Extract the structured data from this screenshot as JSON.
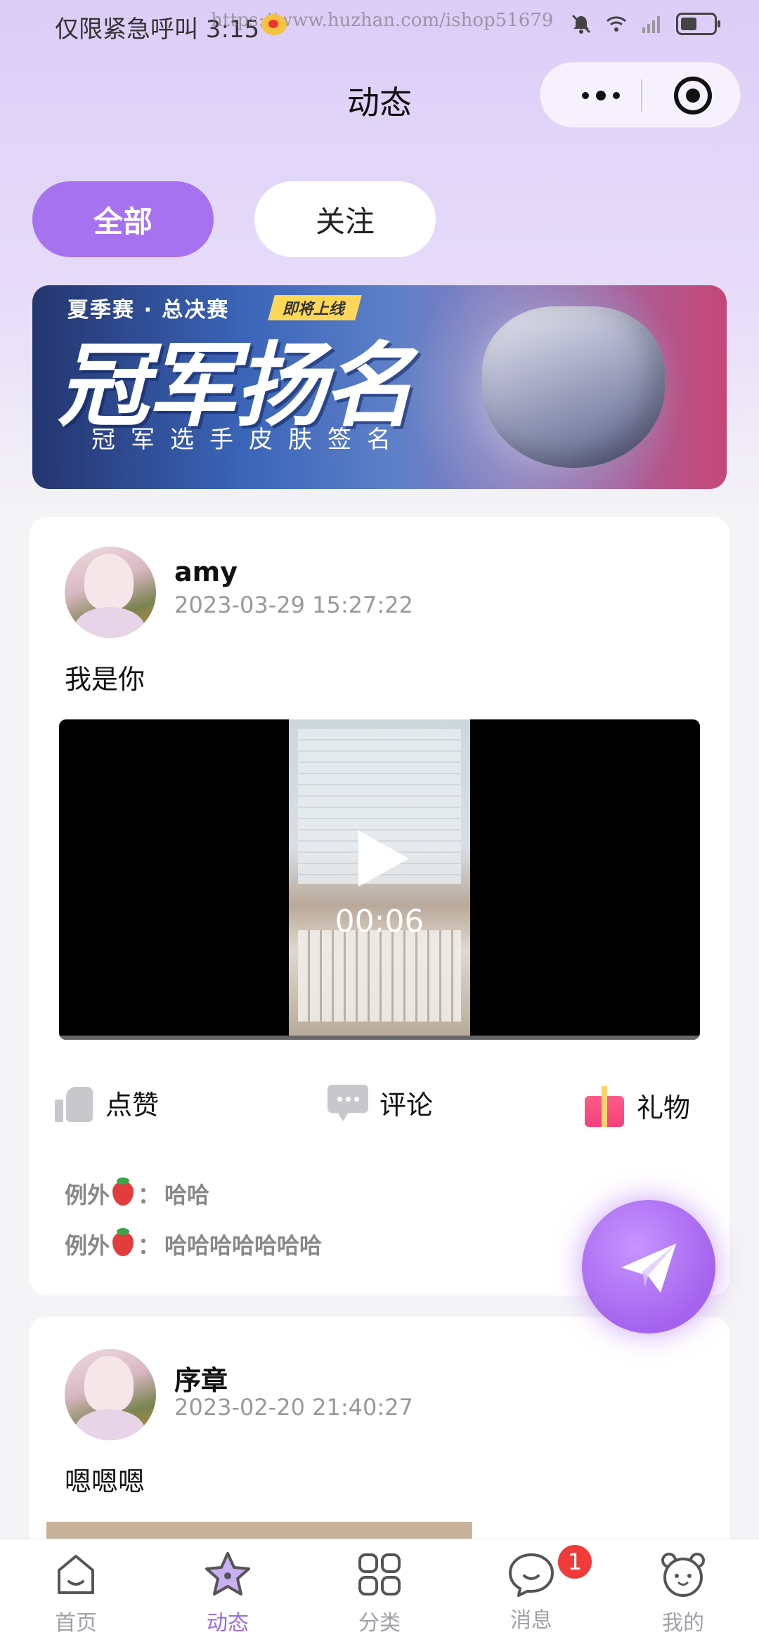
{
  "status_bar": {
    "left_text": "仅限紧急呼叫 3:15",
    "watermark": "https://www.huzhan.com/ishop51679",
    "icons": [
      "weibo-icon",
      "bell-muted-icon",
      "wifi-icon",
      "signal-icon",
      "battery-icon"
    ]
  },
  "nav": {
    "title": "动态",
    "capsule": {
      "more": "more-icon",
      "close": "target-icon"
    }
  },
  "tabs": [
    {
      "label": "全部",
      "active": true
    },
    {
      "label": "关注",
      "active": false
    }
  ],
  "banner": {
    "top_text": "夏季赛 · 总决赛",
    "tag": "即将上线",
    "main_text": "冠军扬名",
    "sub_text": "冠军选手皮肤签名"
  },
  "posts": [
    {
      "user": "amy",
      "time": "2023-03-29 15:27:22",
      "text": "我是你",
      "video": {
        "duration": "00:06"
      },
      "actions": {
        "like": "点赞",
        "comment": "评论",
        "gift": "礼物"
      },
      "comments": [
        {
          "user": "例外",
          "sep": "：",
          "text": "哈哈"
        },
        {
          "user": "例外",
          "sep": "：",
          "text": "哈哈哈哈哈哈哈"
        }
      ]
    },
    {
      "user": "序章",
      "time": "2023-02-20 21:40:27",
      "text": "嗯嗯嗯"
    }
  ],
  "tabbar": [
    {
      "label": "首页",
      "icon": "home-icon",
      "active": false
    },
    {
      "label": "动态",
      "icon": "star-icon",
      "active": true
    },
    {
      "label": "分类",
      "icon": "grid-icon",
      "active": false
    },
    {
      "label": "消息",
      "icon": "chat-icon",
      "active": false,
      "badge": "1"
    },
    {
      "label": "我的",
      "icon": "bear-icon",
      "active": false
    }
  ],
  "colors": {
    "accent": "#a772f0",
    "badge": "#f03b3b",
    "gift": "#f2417b"
  }
}
